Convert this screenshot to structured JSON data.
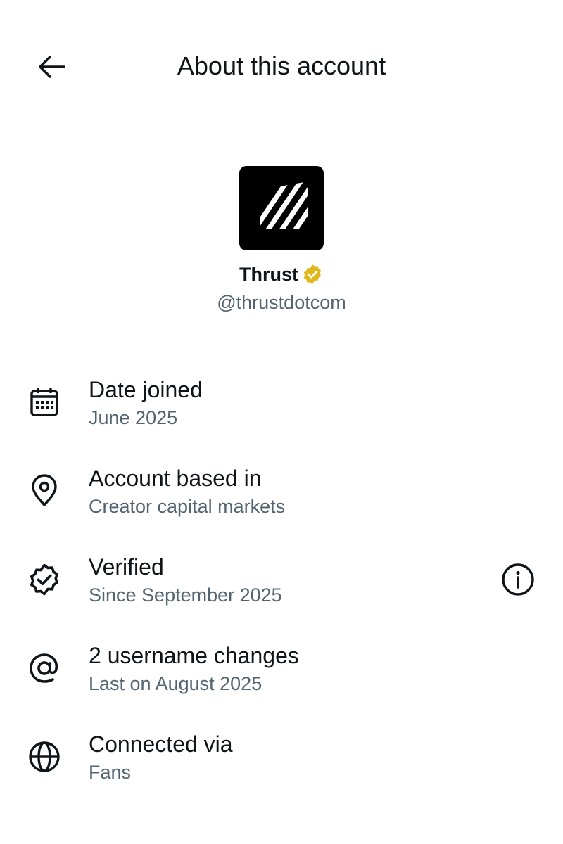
{
  "header": {
    "title": "About this account",
    "back_icon": "arrow-left-icon"
  },
  "profile": {
    "display_name": "Thrust",
    "handle": "@thrustdotcom",
    "verified_badge_color": "#e2b719",
    "avatar_background": "#000000"
  },
  "rows": [
    {
      "icon": "calendar-icon",
      "title": "Date joined",
      "subtitle": "June 2025"
    },
    {
      "icon": "location-pin-icon",
      "title": "Account based in",
      "subtitle": "Creator capital markets"
    },
    {
      "icon": "verified-badge-icon",
      "title": "Verified",
      "subtitle": "Since September 2025",
      "action_icon": "info-icon"
    },
    {
      "icon": "at-sign-icon",
      "title": "2 username changes",
      "subtitle": "Last on August 2025"
    },
    {
      "icon": "globe-icon",
      "title": "Connected via",
      "subtitle": "Fans"
    }
  ],
  "colors": {
    "primary_text": "#0f1419",
    "secondary_text": "#536471"
  }
}
